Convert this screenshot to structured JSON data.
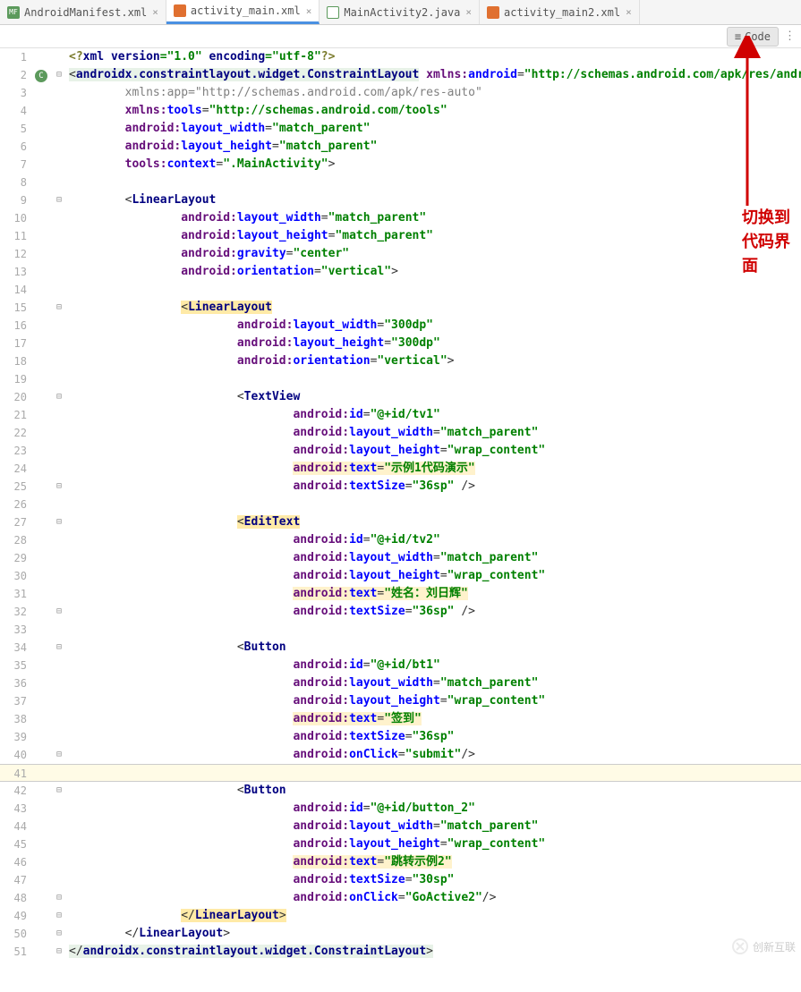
{
  "tabs": [
    {
      "icon_class": "ic-mf",
      "icon": "MF",
      "label": "AndroidManifest.xml",
      "active": false
    },
    {
      "icon_class": "ic-xml",
      "icon": "</>",
      "label": "activity_main.xml",
      "active": true
    },
    {
      "icon_class": "ic-java",
      "icon": "C",
      "label": "MainActivity2.java",
      "active": false
    },
    {
      "icon_class": "ic-xml",
      "icon": "</>",
      "label": "activity_main2.xml",
      "active": false
    }
  ],
  "toolbar": {
    "code_label": "Code"
  },
  "annotation": "切换到\n代码界\n面",
  "watermark": "创新互联",
  "code": {
    "lines": [
      {
        "n": 1,
        "fold": "",
        "html": "<span class='t-pi'>&lt;?</span><span class='t-keyword'>xml version</span><span class='t-str'>=\"1.0\"</span> <span class='t-keyword'>encoding</span><span class='t-str'>=\"utf-8\"</span><span class='t-pi'>?&gt;</span>",
        "indent": 0
      },
      {
        "n": 2,
        "mark": "C",
        "stripe": "green",
        "fold": "⊟",
        "html": "<span class='bg-def'>&lt;<span class='t-keyword'>androidx.constraintlayout.widget.ConstraintLayout</span></span> <span class='t-ns'>xmlns:</span><span class='t-attr'>android</span>=<span class='t-str'>\"http://schemas.android.com/apk/res/android\"</span>",
        "indent": 0
      },
      {
        "n": 3,
        "stripe": "green",
        "html": "<span class='t-gray'>xmlns:app=\"http://schemas.android.com/apk/res-auto\"</span>",
        "indent": 2
      },
      {
        "n": 4,
        "stripe": "green",
        "html": "<span class='t-ns'>xmlns:</span><span class='t-attr'>tools</span>=<span class='t-str'>\"http://schemas.android.com/tools\"</span>",
        "indent": 2
      },
      {
        "n": 5,
        "stripe": "green",
        "html": "<span class='t-ns'>android:</span><span class='t-attr'>layout_width</span>=<span class='t-str'>\"match_parent\"</span>",
        "indent": 2
      },
      {
        "n": 6,
        "stripe": "green",
        "html": "<span class='t-ns'>android:</span><span class='t-attr'>layout_height</span>=<span class='t-str'>\"match_parent\"</span>",
        "indent": 2
      },
      {
        "n": 7,
        "stripe": "green",
        "html": "<span class='t-ns'>tools:</span><span class='t-attr'>context</span>=<span class='t-str'>\".MainActivity\"</span>&gt;",
        "indent": 2
      },
      {
        "n": 8,
        "stripe": "green",
        "html": "",
        "indent": 0
      },
      {
        "n": 9,
        "stripe": "green",
        "fold": "⊟",
        "html": "&lt;<span class='t-keyword'>LinearLayout</span>",
        "indent": 2
      },
      {
        "n": 10,
        "stripe": "green",
        "html": "<span class='t-ns'>android:</span><span class='t-attr'>layout_width</span>=<span class='t-str'>\"match_parent\"</span>",
        "indent": 4
      },
      {
        "n": 11,
        "stripe": "green",
        "html": "<span class='t-ns'>android:</span><span class='t-attr'>layout_height</span>=<span class='t-str'>\"match_parent\"</span>",
        "indent": 4
      },
      {
        "n": 12,
        "stripe": "blue",
        "html": "<span class='t-ns'>android:</span><span class='t-attr'>gravity</span>=<span class='t-str'>\"center\"</span>",
        "indent": 4
      },
      {
        "n": 13,
        "stripe": "green",
        "html": "<span class='t-ns'>android:</span><span class='t-attr'>orientation</span>=<span class='t-str'>\"vertical\"</span>&gt;",
        "indent": 4
      },
      {
        "n": 14,
        "stripe": "green",
        "html": "",
        "indent": 0
      },
      {
        "n": 15,
        "stripe": "green",
        "fold": "⊟",
        "html": "<span class='bg-hl'>&lt;<span class='t-keyword'>LinearLayout</span></span>",
        "indent": 4
      },
      {
        "n": 16,
        "stripe": "green",
        "html": "<span class='t-ns'>android:</span><span class='t-attr'>layout_width</span>=<span class='t-str'>\"300dp\"</span>",
        "indent": 6
      },
      {
        "n": 17,
        "stripe": "green",
        "html": "<span class='t-ns'>android:</span><span class='t-attr'>layout_height</span>=<span class='t-str'>\"300dp\"</span>",
        "indent": 6
      },
      {
        "n": 18,
        "stripe": "green",
        "html": "<span class='t-ns'>android:</span><span class='t-attr'>orientation</span>=<span class='t-str'>\"vertical\"</span>&gt;",
        "indent": 6
      },
      {
        "n": 19,
        "stripe": "green",
        "html": "",
        "indent": 0
      },
      {
        "n": 20,
        "stripe": "green",
        "fold": "⊟",
        "html": "&lt;<span class='t-keyword'>TextView</span>",
        "indent": 6
      },
      {
        "n": 21,
        "stripe": "green",
        "html": "<span class='t-ns'>android:</span><span class='t-attr'>id</span>=<span class='t-str'>\"@+id/tv1\"</span>",
        "indent": 8
      },
      {
        "n": 22,
        "stripe": "green",
        "html": "<span class='t-ns'>android:</span><span class='t-attr'>layout_width</span>=<span class='t-str'>\"match_parent\"</span>",
        "indent": 8
      },
      {
        "n": 23,
        "stripe": "green",
        "html": "<span class='t-ns'>android:</span><span class='t-attr'>layout_height</span>=<span class='t-str'>\"wrap_content\"</span>",
        "indent": 8
      },
      {
        "n": 24,
        "stripe": "green",
        "html": "<span class='bg-hl2'><span class='t-ns'>android:</span><span class='t-attr'>text</span>=<span class='t-str'>\"示例1代码演示\"</span></span>",
        "indent": 8
      },
      {
        "n": 25,
        "stripe": "green",
        "fold": "⊟",
        "html": "<span class='t-ns'>android:</span><span class='t-attr'>textSize</span>=<span class='t-str'>\"36sp\"</span> /&gt;",
        "indent": 8
      },
      {
        "n": 26,
        "stripe": "green",
        "html": "",
        "indent": 0
      },
      {
        "n": 27,
        "stripe": "green",
        "fold": "⊟",
        "html": "<span class='bg-hl'>&lt;<span class='t-keyword'>EditText</span></span>",
        "indent": 6
      },
      {
        "n": 28,
        "stripe": "green",
        "html": "<span class='t-ns'>android:</span><span class='t-attr'>id</span>=<span class='t-str'>\"@+id/tv2\"</span>",
        "indent": 8
      },
      {
        "n": 29,
        "stripe": "green",
        "html": "<span class='t-ns'>android:</span><span class='t-attr'>layout_width</span>=<span class='t-str'>\"match_parent\"</span>",
        "indent": 8
      },
      {
        "n": 30,
        "stripe": "green",
        "html": "<span class='t-ns'>android:</span><span class='t-attr'>layout_height</span>=<span class='t-str'>\"wrap_content\"</span>",
        "indent": 8
      },
      {
        "n": 31,
        "stripe": "green",
        "html": "<span class='bg-hl2'><span class='t-ns'>android:</span><span class='t-attr'>text</span>=<span class='t-str'>\"姓名：刘日辉\"</span></span>",
        "indent": 8
      },
      {
        "n": 32,
        "stripe": "green",
        "fold": "⊟",
        "html": "<span class='t-ns'>android:</span><span class='t-attr'>textSize</span>=<span class='t-str'>\"36sp\"</span> /&gt;",
        "indent": 8
      },
      {
        "n": 33,
        "stripe": "green",
        "html": "",
        "indent": 0
      },
      {
        "n": 34,
        "stripe": "green",
        "fold": "⊟",
        "html": "&lt;<span class='t-keyword'>Button</span>",
        "indent": 6
      },
      {
        "n": 35,
        "stripe": "green",
        "html": "<span class='t-ns'>android:</span><span class='t-attr'>id</span>=<span class='t-str'>\"@+id/bt1\"</span>",
        "indent": 8
      },
      {
        "n": 36,
        "stripe": "green",
        "html": "<span class='t-ns'>android:</span><span class='t-attr'>layout_width</span>=<span class='t-str'>\"match_parent\"</span>",
        "indent": 8
      },
      {
        "n": 37,
        "stripe": "green",
        "html": "<span class='t-ns'>android:</span><span class='t-attr'>layout_height</span>=<span class='t-str'>\"wrap_content\"</span>",
        "indent": 8
      },
      {
        "n": 38,
        "stripe": "green",
        "html": "<span class='bg-hl2'><span class='t-ns'>android:</span><span class='t-attr'>text</span>=<span class='t-str'>\"签到\"</span></span>",
        "indent": 8
      },
      {
        "n": 39,
        "stripe": "green",
        "html": "<span class='t-ns'>android:</span><span class='t-attr'>textSize</span>=<span class='t-str'>\"36sp\"</span>",
        "indent": 8
      },
      {
        "n": 40,
        "stripe": "green",
        "fold": "⊟",
        "html": "<span class='t-ns'>android:</span><span class='t-attr'>onClick</span>=<span class='t-str'>\"submit\"</span>/&gt;",
        "indent": 8
      },
      {
        "n": 41,
        "stripe": "green",
        "current": true,
        "html": "",
        "indent": 0
      },
      {
        "n": 42,
        "stripe": "green",
        "fold": "⊟",
        "html": "&lt;<span class='t-keyword'>Button</span>",
        "indent": 6
      },
      {
        "n": 43,
        "stripe": "green",
        "html": "<span class='t-ns'>android:</span><span class='t-attr'>id</span>=<span class='t-str'>\"@+id/button_2\"</span>",
        "indent": 8
      },
      {
        "n": 44,
        "stripe": "green",
        "html": "<span class='t-ns'>android:</span><span class='t-attr'>layout_width</span>=<span class='t-str'>\"match_parent\"</span>",
        "indent": 8
      },
      {
        "n": 45,
        "stripe": "green",
        "html": "<span class='t-ns'>android:</span><span class='t-attr'>layout_height</span>=<span class='t-str'>\"wrap_content\"</span>",
        "indent": 8
      },
      {
        "n": 46,
        "stripe": "green",
        "html": "<span class='bg-hl2'><span class='t-ns'>android:</span><span class='t-attr'>text</span>=<span class='t-str'>\"跳转示例2\"</span></span>",
        "indent": 8
      },
      {
        "n": 47,
        "stripe": "green",
        "html": "<span class='t-ns'>android:</span><span class='t-attr'>textSize</span>=<span class='t-str'>\"30sp\"</span>",
        "indent": 8
      },
      {
        "n": 48,
        "stripe": "green",
        "fold": "⊟",
        "html": "<span class='t-ns'>android:</span><span class='t-attr'>onClick</span>=<span class='t-str'>\"GoActive2\"</span>/&gt;",
        "indent": 8
      },
      {
        "n": 49,
        "stripe": "green",
        "fold": "⊟",
        "html": "<span class='bg-hl'>&lt;/<span class='t-keyword'>LinearLayout</span>&gt;</span>",
        "indent": 4
      },
      {
        "n": 50,
        "stripe": "green",
        "fold": "⊟",
        "html": "&lt;/<span class='t-keyword'>LinearLayout</span>&gt;",
        "indent": 2
      },
      {
        "n": 51,
        "stripe": "green",
        "fold": "⊟",
        "html": "<span class='bg-def'>&lt;/<span class='t-keyword'>androidx.constraintlayout.widget.ConstraintLayout</span>&gt;</span>",
        "indent": 0
      }
    ]
  }
}
